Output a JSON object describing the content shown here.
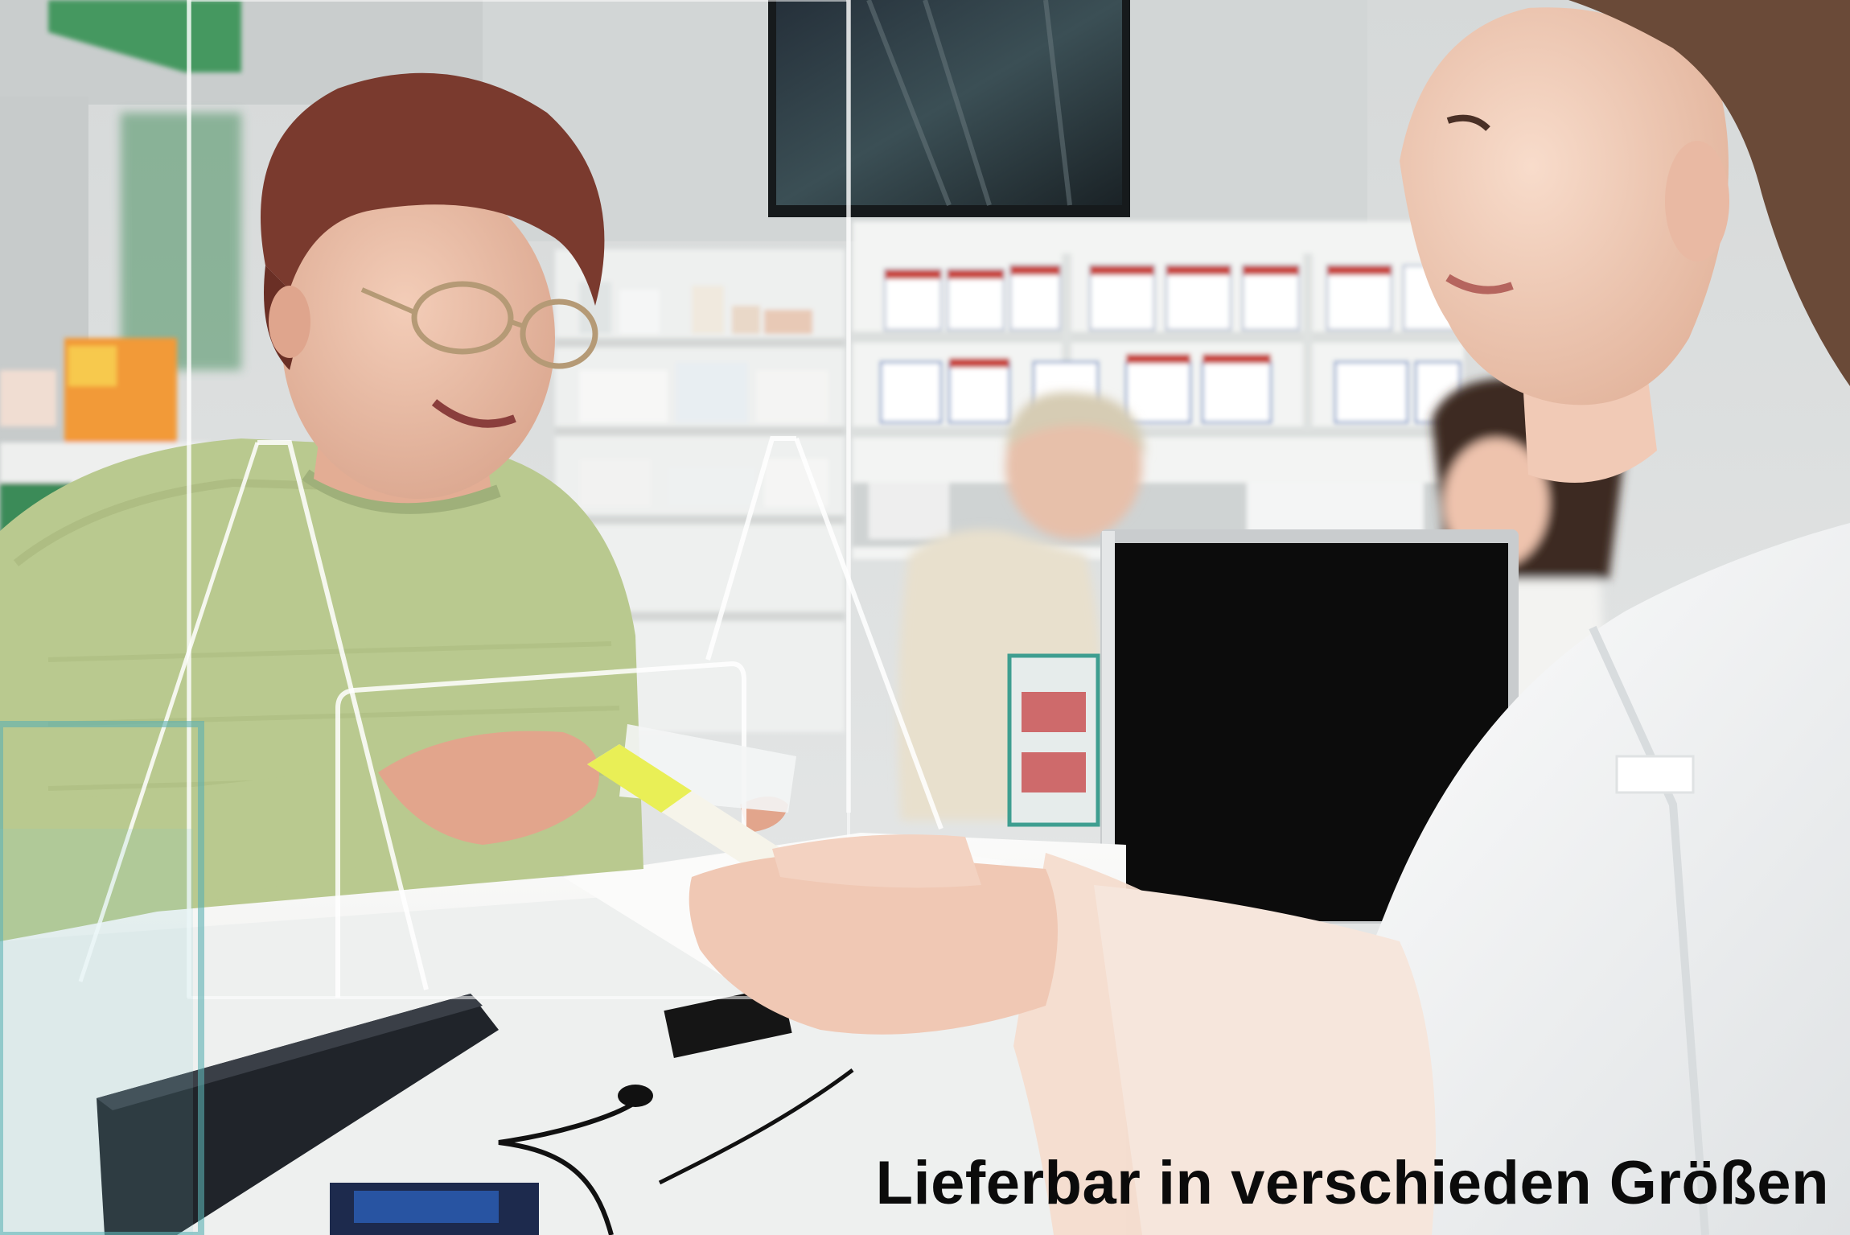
{
  "caption": {
    "text": "Lieferbar in verschieden Größen"
  },
  "palette": {
    "wall": "#dfe2e1",
    "shelf": "#f3f4f3",
    "counter": "#f4f4f2",
    "sweater": "#b9c98f",
    "hair": "#7a3a2e",
    "coat": "#f7f7f5",
    "monitor": "#0c0c0c",
    "caption": "#0b0b0b"
  }
}
